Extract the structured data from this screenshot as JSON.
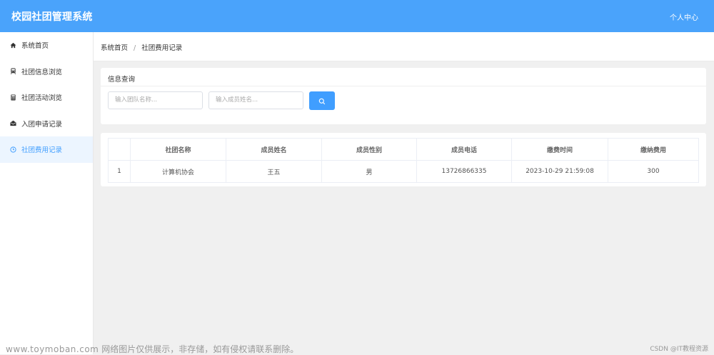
{
  "header": {
    "app_title": "校园社团管理系统",
    "user_center": "个人中心"
  },
  "sidebar": {
    "items": [
      {
        "label": "系统首页",
        "icon": "home-icon"
      },
      {
        "label": "社团信息浏览",
        "icon": "train-icon"
      },
      {
        "label": "社团活动浏览",
        "icon": "calculator-icon"
      },
      {
        "label": "入团申请记录",
        "icon": "envelope-icon"
      },
      {
        "label": "社团费用记录",
        "icon": "clock-icon",
        "active": true
      }
    ]
  },
  "breadcrumb": {
    "home": "系统首页",
    "separator": "/",
    "current": "社团费用记录"
  },
  "query": {
    "title": "信息查询",
    "team_placeholder": "输入团队名称...",
    "member_placeholder": "输入成员姓名...",
    "search_icon": "search-icon"
  },
  "table": {
    "columns": [
      "",
      "社团名称",
      "成员姓名",
      "成员性别",
      "成员电话",
      "缴费时间",
      "缴纳费用"
    ],
    "rows": [
      [
        "1",
        "计算机协会",
        "王五",
        "男",
        "13726866335",
        "2023-10-29 21:59:08",
        "300"
      ]
    ]
  },
  "footer": {
    "watermark_url": "www.toymoban.com",
    "watermark_text": "网络图片仅供展示，非存储，如有侵权请联系删除。",
    "credit": "CSDN @IT教程资源"
  },
  "colors": {
    "header_bg": "#4aa3fb",
    "accent": "#409eff",
    "active_bg": "#ecf5ff",
    "page_bg": "#f0f0f0"
  }
}
